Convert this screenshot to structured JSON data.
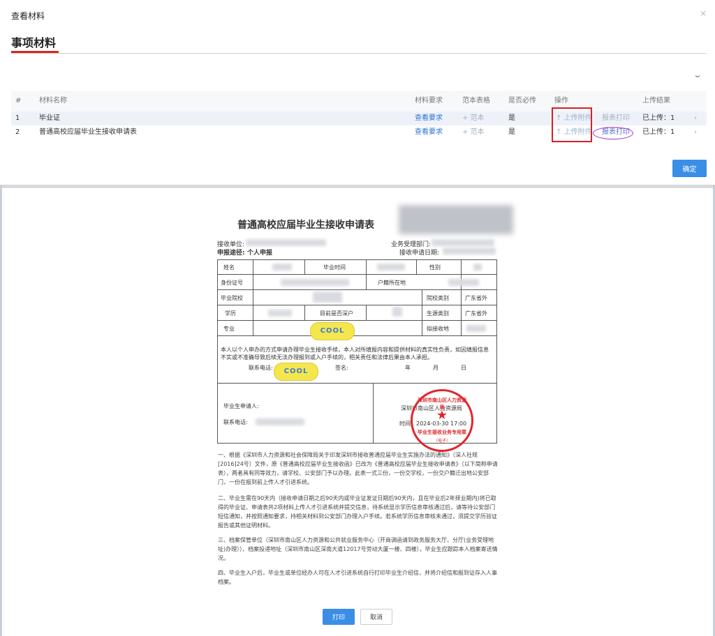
{
  "modal": {
    "title": "查看材料",
    "close": "×",
    "section_title": "事项材料",
    "confirm_label": "确定",
    "colors": {
      "accent": "#d9261c",
      "primary_button": "#3a8ee6",
      "link": "#2a73d6",
      "op_highlight_box": "#d42027",
      "print_highlight": "#a13cc7"
    }
  },
  "table": {
    "headers": {
      "idx": "#",
      "name": "材料名称",
      "req": "材料要求",
      "tpl": "范本表格",
      "must": "是否必传",
      "op": "操作",
      "res": "上传结果"
    },
    "rows": [
      {
        "idx": "1",
        "name": "毕业证",
        "req": "查看要求",
        "tpl": "+ 范本",
        "must": "是",
        "upload": "↑ 上传附件",
        "print": "报表打印",
        "res": "已上传：1",
        "arrow": "›"
      },
      {
        "idx": "2",
        "name": "普通高校应届毕业生接收申请表",
        "req": "查看要求",
        "tpl": "+ 范本",
        "must": "是",
        "upload": "↑ 上传附件",
        "print": "报表打印",
        "res": "已上传：1",
        "arrow": "›"
      }
    ]
  },
  "doc": {
    "title": "普通高校应届毕业生接收申请表",
    "receive_unit_label": "接收单位:",
    "dept_label": "业务受理部门:",
    "channel_label": "申报途径:",
    "channel_value": "个人申报",
    "apply_date_label": "接收申请日期:",
    "form": {
      "name": "姓名",
      "grad_time": "毕业时间",
      "gender": "性别",
      "id_no": "身份证号",
      "huji": "户籍所在地",
      "school": "毕业院校",
      "school_type": "院校类别",
      "school_type_val": "广东省外",
      "edu": "学历",
      "shenhu": "目前是否深户",
      "origin_type": "生源类别",
      "origin_type_val": "广东省外",
      "major": "专业",
      "intended_place": "拟接收地"
    },
    "declaration": "本人以个人申办的方式申请办理毕业生接收手续，本人对所填报内容和提供材料的真实性负责，如因填报信息不实或不准确导致后续无法办理报到或入户手续的，相关责任和法律后果由本人承担。",
    "contact_label": "联系电话:",
    "sign_label": "签名:",
    "year": "年",
    "month": "月",
    "day": "日",
    "applicant_label": "毕业生申请人:",
    "contact2_label": "联系电话:",
    "bureau": "深圳市南山区人力资源局",
    "time_label": "时间：2024-03-30 17:00",
    "badge": "COOL",
    "stamp": {
      "top": "深圳市南山区人力资源局",
      "bottom": "毕业生接收业务专用章",
      "sub": "（电子）",
      "star": "★"
    },
    "notes": [
      "一、根据《深圳市人力资源和社会保障局关于印发深圳市接收普通应届毕业生实施办法的通知》（深人社规[2016]24号）文件，原《普通高校应届毕业生接收函》已改为《普通高校应届毕业生接收申请表》（以下简称申请表），两者具有同等效力，请学校、公安部门予以办理。此表一式三份，一份交学校，一份交户籍迁出地公安部门，一份在报到前上传人才引进系统。",
      "二、毕业生需在90天内（接收申请日期之后90天内或毕业证发证日期后90天内，且在毕业后2年择业期内)将已取得的毕业证、申请表共2项材料上传人才引进系统并提交信息，待系统显示学历信息审核通过后，请等待公安部门短信通知，并按照通知要求，持相关材料到公安部门办理入户手续。若系统学历信息审核未通过，须提交学历验证报告或其他证明材料。",
      "三、档案保管单位（深圳市南山区人力资源和公共就业服务中心（开商调函请到政务服务大厅、分厅(业务受理地址)办理））、档案投递地址（深圳市南山区深南大道12017号劳动大厦一楼、四楼），毕业生应跟踪本人档案寄送情况。",
      "四、毕业生入户后，毕业生或单位经办人可在人才引进系统自行打印毕业生介绍信，并将介绍信和报到证存入人事档案。"
    ],
    "print_label": "打印",
    "cancel_label": "取消"
  }
}
